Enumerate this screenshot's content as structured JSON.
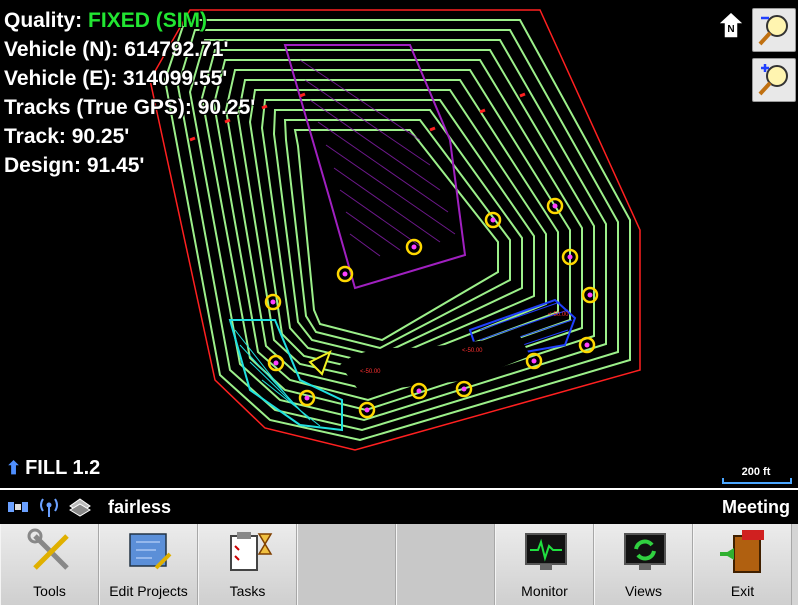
{
  "overlay": {
    "quality_label": "Quality:",
    "quality_value": "FIXED (SIM)",
    "vehicle_n": "Vehicle (N): 614792.71'",
    "vehicle_e": "Vehicle (E): 314099.55'",
    "tracks_true_gps": "Tracks (True GPS): 90.25'",
    "track": "Track: 90.25'",
    "design": "Design: 91.45'"
  },
  "fill": {
    "label": "FILL 1.2"
  },
  "scale": {
    "label": "200 ft"
  },
  "north": {
    "label": "N"
  },
  "status": {
    "project_name": "fairless",
    "right_label": "Meeting"
  },
  "toolbar": {
    "tools": "Tools",
    "edit_projects": "Edit Projects",
    "tasks": "Tasks",
    "monitor": "Monitor",
    "views": "Views",
    "exit": "Exit"
  },
  "map": {
    "small_labels": [
      "<-50.00",
      "<-50.00",
      "<-50.00"
    ],
    "colors": {
      "contour": "#9cf08a",
      "boundary": "#ff2020",
      "design_pad": "#a020c0",
      "hatch_blue": "#2040ff",
      "hatch_cyan": "#20e0e0",
      "marker": "#ffd800"
    }
  }
}
